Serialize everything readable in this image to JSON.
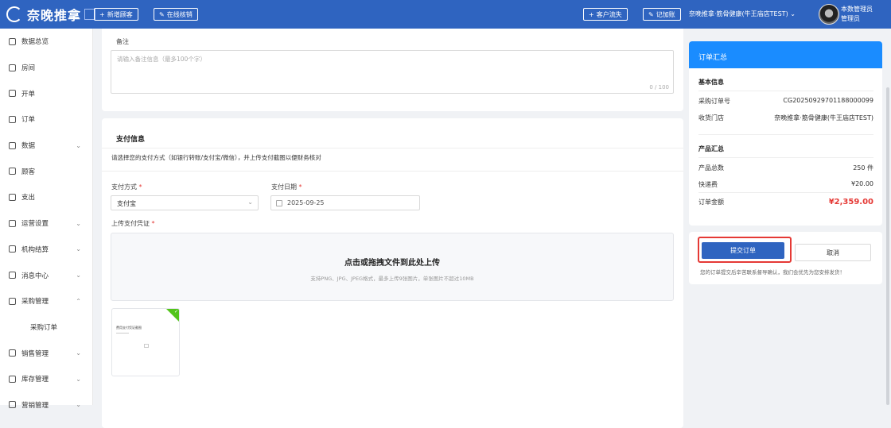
{
  "topbar": {
    "logo_text": "奈晚推拿",
    "new_customer": "新增顾客",
    "writeoff": "在线核销",
    "customer_loss": "客户流失",
    "bookkeeping": "记加账",
    "store_name": "奈晚推拿·筋骨健康(牛王庙店TEST)",
    "user_role_1": "本数管理员",
    "user_role_2": "管理员"
  },
  "sidebar": {
    "items": [
      {
        "label": "数据总览",
        "icon": "dashboard-icon"
      },
      {
        "label": "房间",
        "icon": "home-icon"
      },
      {
        "label": "开单",
        "icon": "document-icon"
      },
      {
        "label": "订单",
        "icon": "clipboard-icon"
      },
      {
        "label": "数据",
        "icon": "chart-icon"
      },
      {
        "label": "顾客",
        "icon": "user-icon"
      },
      {
        "label": "支出",
        "icon": "wallet-icon"
      },
      {
        "label": "运营设置",
        "icon": "monitor-icon"
      },
      {
        "label": "机构结算",
        "icon": "coin-icon"
      },
      {
        "label": "消息中心",
        "icon": "message-icon"
      },
      {
        "label": "采购管理",
        "icon": "cart-icon"
      },
      {
        "label": "采购订单",
        "icon": ""
      },
      {
        "label": "销售管理",
        "icon": "sales-icon"
      },
      {
        "label": "库存管理",
        "icon": "box-icon"
      },
      {
        "label": "营销管理",
        "icon": "megaphone-icon"
      }
    ]
  },
  "remark": {
    "label": "备注",
    "placeholder": "请输入备注信息（最多100个字）",
    "counter": "0 / 100"
  },
  "payment": {
    "title": "支付信息",
    "desc": "请选择您的支付方式（如银行转账/支付宝/微信），并上传支付截图以便财务核对",
    "method_label": "支付方式",
    "method_value": "支付宝",
    "date_label": "支付日期",
    "date_value": "2025-09-25",
    "upload_label": "上传支付凭证",
    "upload_main": "点击或拖拽文件到此处上传",
    "upload_sub": "支持PNG、JPG、JPEG格式，最多上传9张图片，单张图片不超过10MB",
    "thumb_caption": "费用支付凭证截图"
  },
  "summary": {
    "header": "订单汇总",
    "basic_title": "基本信息",
    "order_no_label": "采购订单号",
    "order_no": "CG20250929701188000099",
    "store_label": "收货门店",
    "store_value": "奈晚推拿·筋骨健康(牛王庙店TEST)",
    "product_title": "产品汇总",
    "total_qty_label": "产品总数",
    "total_qty": "250 件",
    "shipping_label": "快递费",
    "shipping": "¥20.00",
    "amount_label": "订单金额",
    "amount": "¥2,359.00"
  },
  "actions": {
    "submit": "提交订单",
    "cancel": "取消",
    "notice": "您的订单提交后辛苦联系督导确认，我们会优先为您安排发货！"
  },
  "colors": {
    "primary": "#2f64c0",
    "summary_header": "#1a8cff",
    "highlight": "#e53935"
  }
}
